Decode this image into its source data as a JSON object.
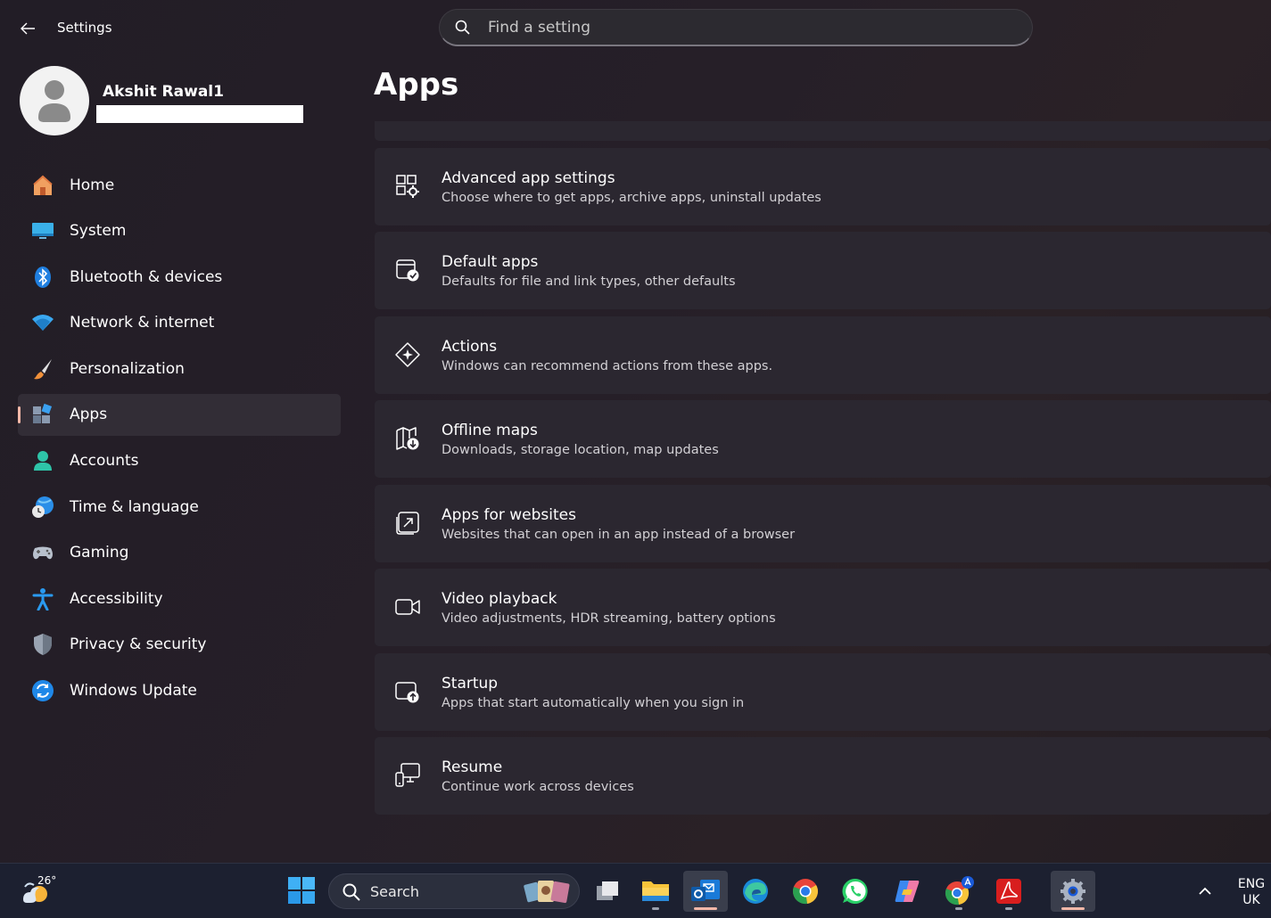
{
  "window": {
    "title": "Settings"
  },
  "search": {
    "placeholder": "Find a setting"
  },
  "profile": {
    "name": "Akshit Rawal1"
  },
  "colors": {
    "accent": "#f4b8a8",
    "card": "#2b2730",
    "nav_active": "#322d36"
  },
  "sidebar": {
    "items": [
      {
        "label": "Home",
        "icon": "home-icon"
      },
      {
        "label": "System",
        "icon": "system-icon"
      },
      {
        "label": "Bluetooth & devices",
        "icon": "bluetooth-icon"
      },
      {
        "label": "Network & internet",
        "icon": "wifi-icon"
      },
      {
        "label": "Personalization",
        "icon": "brush-icon"
      },
      {
        "label": "Apps",
        "icon": "apps-icon",
        "active": true
      },
      {
        "label": "Accounts",
        "icon": "accounts-icon"
      },
      {
        "label": "Time & language",
        "icon": "globe-clock-icon"
      },
      {
        "label": "Gaming",
        "icon": "gamepad-icon"
      },
      {
        "label": "Accessibility",
        "icon": "accessibility-icon"
      },
      {
        "label": "Privacy & security",
        "icon": "shield-icon"
      },
      {
        "label": "Windows Update",
        "icon": "update-icon"
      }
    ]
  },
  "main": {
    "title": "Apps",
    "cards": [
      {
        "title": "Advanced app settings",
        "desc": "Choose where to get apps, archive apps, uninstall updates",
        "icon": "advanced-app-settings-icon"
      },
      {
        "title": "Default apps",
        "desc": "Defaults for file and link types, other defaults",
        "icon": "default-apps-icon"
      },
      {
        "title": "Actions",
        "desc": "Windows can recommend actions from these apps.",
        "icon": "actions-icon"
      },
      {
        "title": "Offline maps",
        "desc": "Downloads, storage location, map updates",
        "icon": "offline-maps-icon"
      },
      {
        "title": "Apps for websites",
        "desc": "Websites that can open in an app instead of a browser",
        "icon": "apps-for-websites-icon"
      },
      {
        "title": "Video playback",
        "desc": "Video adjustments, HDR streaming, battery options",
        "icon": "video-camera-icon"
      },
      {
        "title": "Startup",
        "desc": "Apps that start automatically when you sign in",
        "icon": "startup-icon"
      },
      {
        "title": "Resume",
        "desc": "Continue work across devices",
        "icon": "resume-icon"
      }
    ]
  },
  "taskbar": {
    "weather_temp": "26°",
    "search_label": "Search",
    "apps": [
      "task-view-icon",
      "file-explorer-icon",
      "outlook-icon",
      "edge-icon",
      "chrome-icon",
      "whatsapp-icon",
      "copilot-icon",
      "chrome-profile-icon",
      "acrobat-icon",
      "settings-icon"
    ],
    "lang_line1": "ENG",
    "lang_line2": "UK"
  }
}
